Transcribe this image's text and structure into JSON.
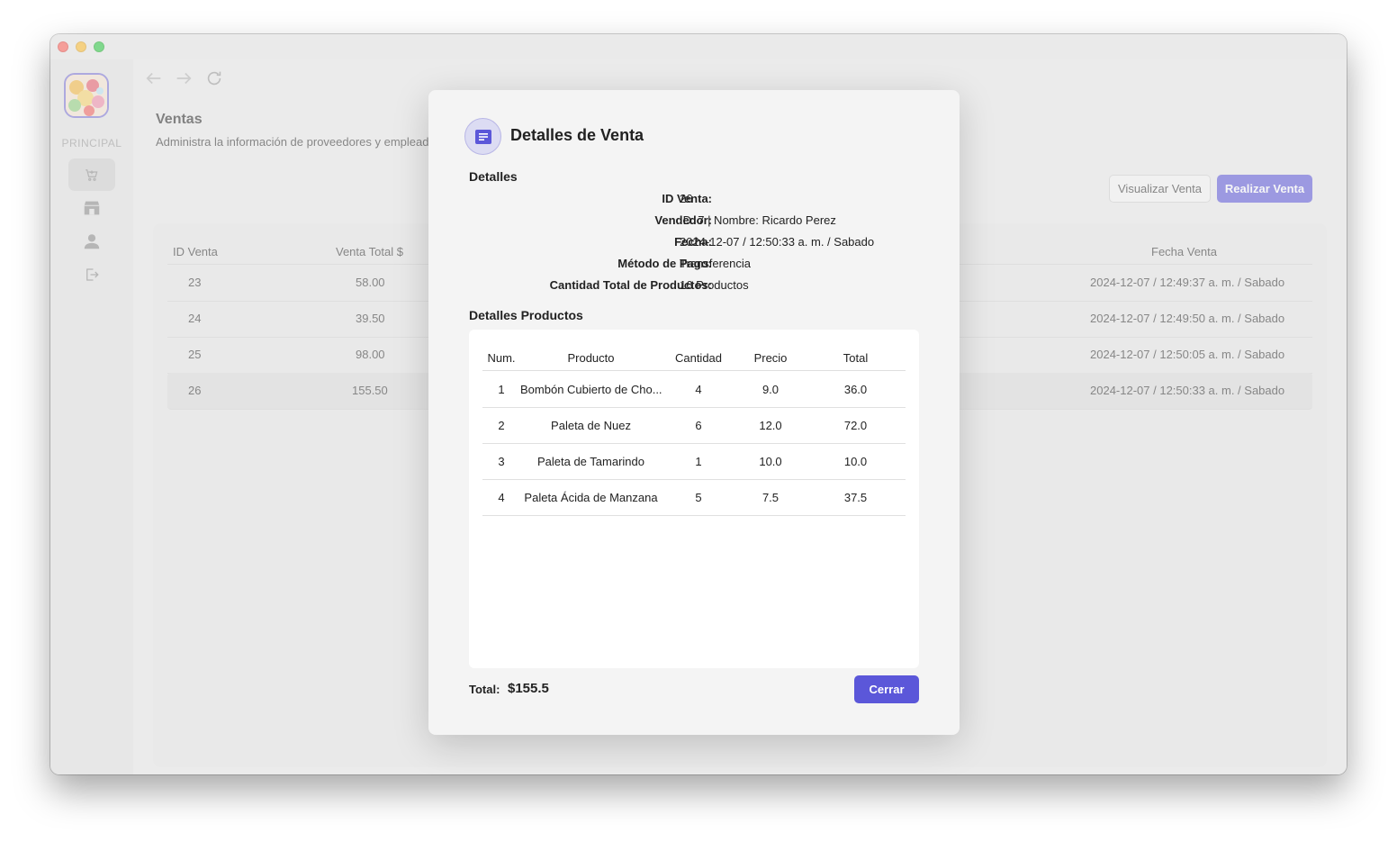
{
  "sidebar": {
    "section_label": "PRINCIPAL",
    "items": [
      {
        "icon": "cart-icon",
        "active": true
      },
      {
        "icon": "store-icon",
        "active": false
      },
      {
        "icon": "user-icon",
        "active": false
      },
      {
        "icon": "logout-icon",
        "active": false
      }
    ]
  },
  "header": {
    "title": "Ventas",
    "subtitle": "Administra la información de proveedores y empleado"
  },
  "toolbar": {
    "view_label": "Visualizar Venta",
    "make_label": "Realizar Venta"
  },
  "table": {
    "columns": [
      "ID Venta",
      "Venta Total $",
      "Fecha Venta"
    ],
    "rows": [
      {
        "id": "23",
        "total": "58.00",
        "fecha": "2024-12-07 / 12:49:37 a. m. / Sabado"
      },
      {
        "id": "24",
        "total": "39.50",
        "fecha": "2024-12-07 / 12:49:50 a. m. / Sabado"
      },
      {
        "id": "25",
        "total": "98.00",
        "fecha": "2024-12-07 / 12:50:05 a. m. / Sabado"
      },
      {
        "id": "26",
        "total": "155.50",
        "fecha": "2024-12-07 / 12:50:33 a. m. / Sabado"
      }
    ]
  },
  "modal": {
    "title": "Detalles de Venta",
    "details_heading": "Detalles",
    "details": [
      {
        "key": "ID Venta:",
        "value": "26"
      },
      {
        "key": "Vendedor:",
        "value": "ID: 7 | Nombre: Ricardo Perez"
      },
      {
        "key": "Fecha:",
        "value": "2024-12-07 / 12:50:33 a. m. / Sabado"
      },
      {
        "key": "Método de Pago:",
        "value": "Transferencia"
      },
      {
        "key": "Cantidad Total de Productos:",
        "value": "16 Productos"
      }
    ],
    "products_heading": "Detalles Productos",
    "product_columns": [
      "Num.",
      "Producto",
      "Cantidad",
      "Precio",
      "Total"
    ],
    "products": [
      {
        "num": "1",
        "name": "Bombón Cubierto de Cho...",
        "qty": "4",
        "price": "9.0",
        "total": "36.0"
      },
      {
        "num": "2",
        "name": "Paleta de Nuez",
        "qty": "6",
        "price": "12.0",
        "total": "72.0"
      },
      {
        "num": "3",
        "name": "Paleta de Tamarindo",
        "qty": "1",
        "price": "10.0",
        "total": "10.0"
      },
      {
        "num": "4",
        "name": "Paleta Ácida de Manzana",
        "qty": "5",
        "price": "7.5",
        "total": "37.5"
      }
    ],
    "total_label": "Total:",
    "total_value": "$155.5",
    "close_label": "Cerrar"
  },
  "colors": {
    "accent": "#5b57d9",
    "selected_row": "#dcdcdc"
  }
}
